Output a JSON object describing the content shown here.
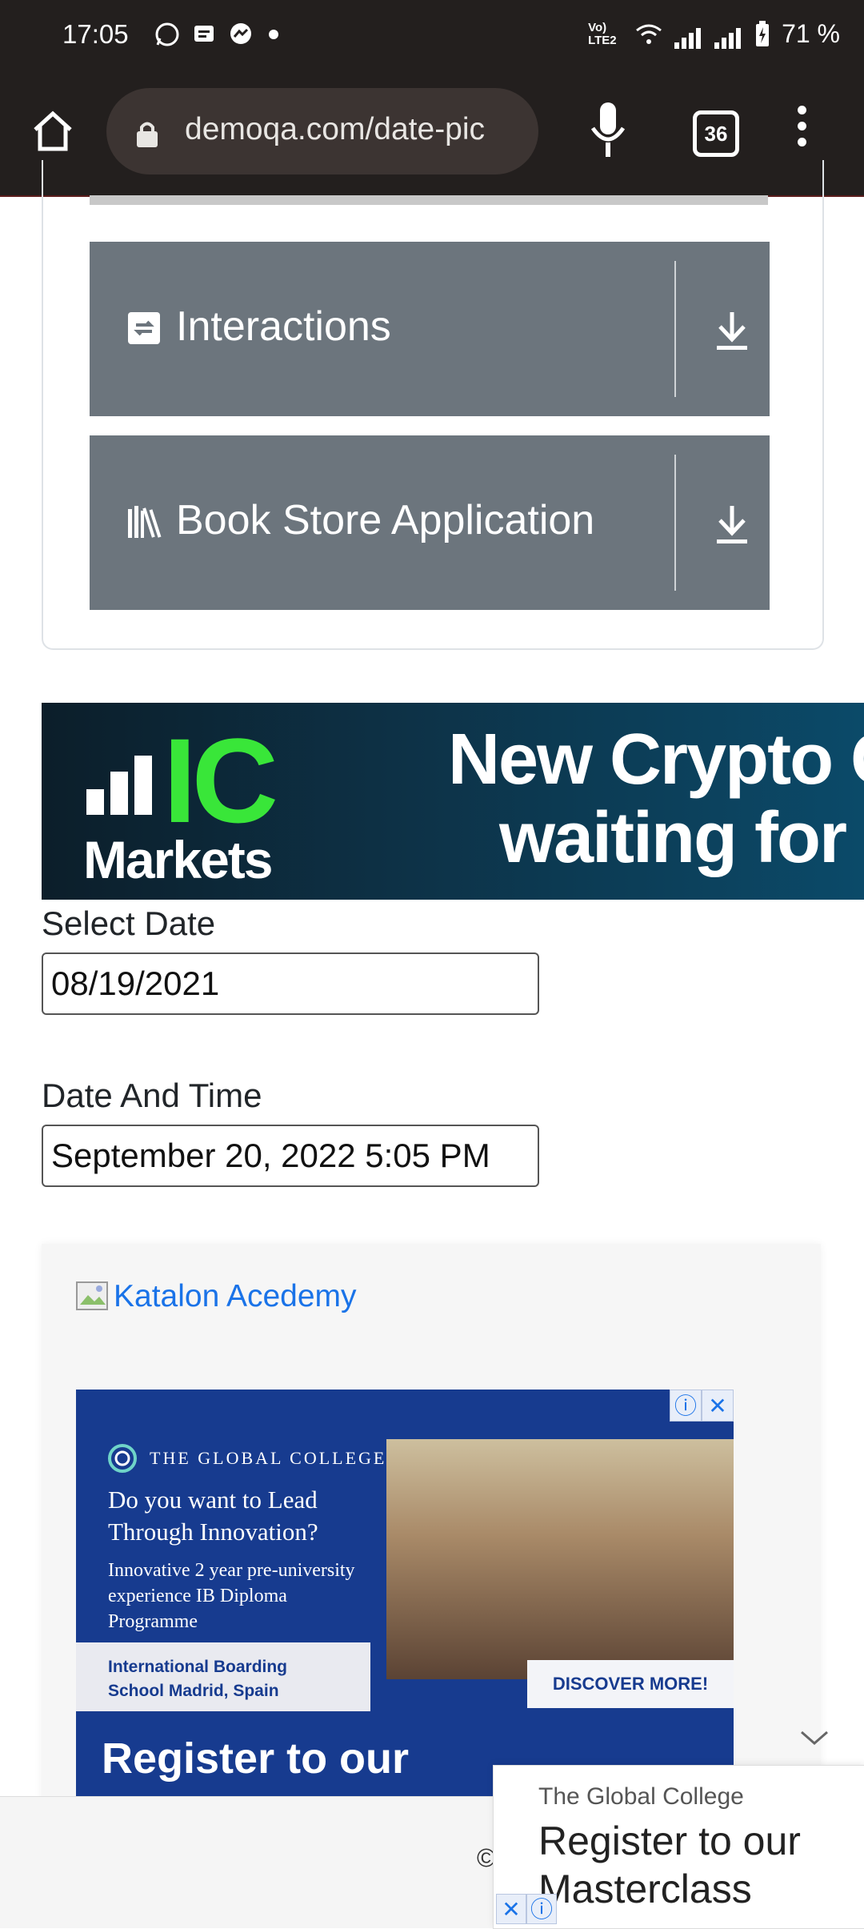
{
  "status_bar": {
    "time": "17:05",
    "battery": "71 %",
    "network_label": "Vo) LTE2"
  },
  "browser": {
    "url": "demoqa.com/date-pic",
    "tab_count": "36"
  },
  "sidebar": {
    "groups": [
      {
        "label": "Interactions",
        "icon": "interactions-icon"
      },
      {
        "label": "Book Store Application",
        "icon": "bookstore-icon"
      }
    ]
  },
  "ad_banner": {
    "brand_ic": "IC",
    "brand_markets": "Markets",
    "headline_line1": "New Crypto C",
    "headline_line2": "waiting for y"
  },
  "form": {
    "select_date_label": "Select Date",
    "select_date_value": "08/19/2021",
    "date_time_label": "Date And Time",
    "date_time_value": "September 20, 2022 5:05 PM"
  },
  "katalon": {
    "link_text": "Katalon Acedemy"
  },
  "college_ad": {
    "logo_text": "THE GLOBAL COLLEGE",
    "question": "Do you want to Lead Through Innovation?",
    "sub": "Innovative 2 year pre-university experience IB Diploma Programme",
    "box": "International Boarding School Madrid, Spain",
    "discover": "DISCOVER MORE!",
    "register": "Register to our"
  },
  "footer": {
    "copyright": "©"
  },
  "bottom_ad": {
    "advertiser": "The Global College",
    "headline": "Register to our Masterclass"
  }
}
